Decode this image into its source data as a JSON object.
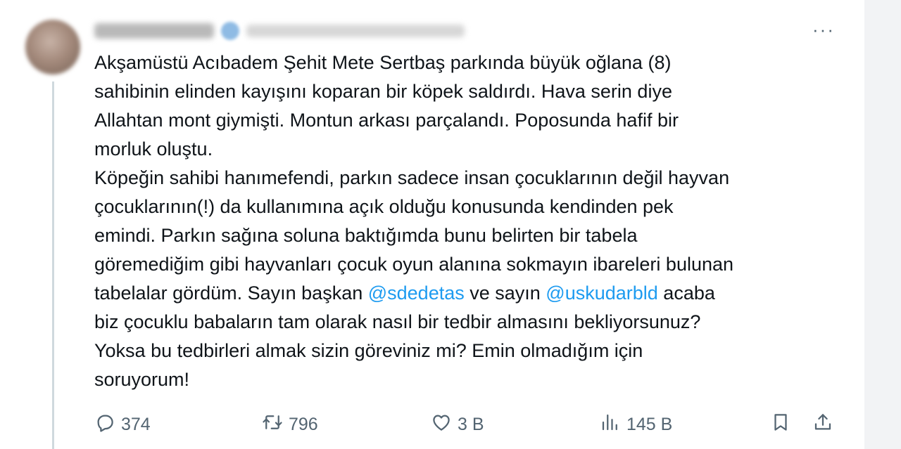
{
  "tweet": {
    "text_lines": [
      "Akşamüstü Acıbadem Şehit Mete Sertbaş parkında büyük oğlana (8)",
      "sahibinin elinden kayışını koparan bir köpek saldırdı. Hava serin diye",
      "Allahtan mont giymişti. Montun arkası parçalandı. Poposunda hafif bir",
      "morluk oluştu.",
      "Köpeğin sahibi hanımefendi, parkın sadece insan çocuklarının değil hayvan",
      "çocuklarının(!) da kullanımına açık olduğu konusunda kendinden pek",
      "emindi. Parkın sağına soluna baktığımda bunu belirten bir tabela",
      "göremediğim gibi hayvanları çocuk oyun alanına sokmayın ibareleri bulunan"
    ],
    "line9_before": "tabelalar gördüm. Sayın başkan ",
    "mention_1": "@sdedetas",
    "line9_middle": " ve sayın ",
    "mention_2": "@uskudarbld",
    "line9_after": " acaba",
    "text_lines_end": [
      "biz çocuklu babaların tam olarak nasıl bir tedbir almasını bekliyorsunuz?",
      "Yoksa bu tedbirleri almak sizin göreviniz mi? Emin olmadığım için",
      "soruyorum!"
    ]
  },
  "actions": {
    "replies": "374",
    "retweets": "796",
    "likes": "3 B",
    "views": "145 B"
  },
  "icons": {
    "more": "more-icon",
    "reply": "reply-icon",
    "retweet": "retweet-icon",
    "like": "heart-icon",
    "views": "views-icon",
    "bookmark": "bookmark-icon",
    "share": "share-icon"
  },
  "colors": {
    "text": "#0f1419",
    "secondary": "#536471",
    "mention": "#1d9bf0",
    "thread_line": "#cfd9de"
  }
}
